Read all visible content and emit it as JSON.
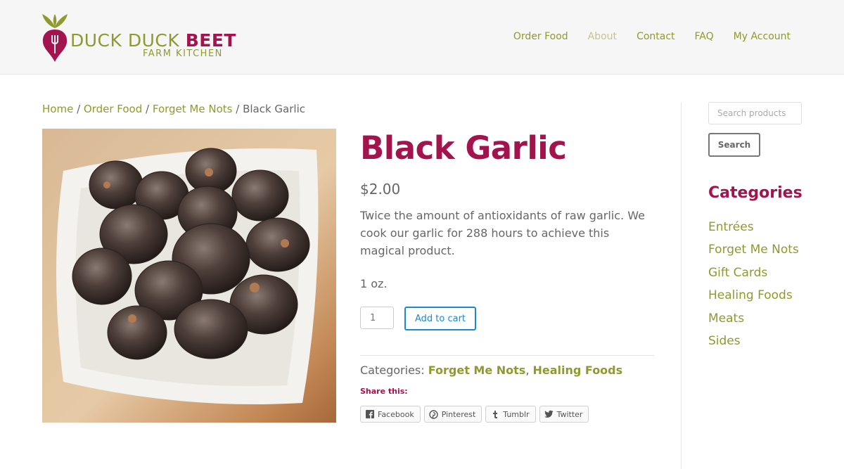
{
  "header": {
    "logo": {
      "line1": "DUCK DUCK ",
      "line1_bold": "BEET",
      "line2": "FARM KITCHEN"
    },
    "nav": [
      {
        "label": "Order Food",
        "active": false
      },
      {
        "label": "About",
        "active": true
      },
      {
        "label": "Contact",
        "active": false
      },
      {
        "label": "FAQ",
        "active": false
      },
      {
        "label": "My Account",
        "active": false
      }
    ]
  },
  "breadcrumb": {
    "items": [
      "Home",
      "Order Food",
      "Forget Me Nots"
    ],
    "separator": " / ",
    "current": "Black Garlic"
  },
  "product": {
    "title": "Black Garlic",
    "price": "$2.00",
    "description": "Twice the amount of antioxidants of raw garlic. We cook our garlic for 288 hours to achieve this magical product.",
    "weight": "1 oz.",
    "quantity": "1",
    "add_to_cart": "Add to cart",
    "categories_label": "Categories: ",
    "categories": [
      "Forget Me Nots",
      "Healing Foods"
    ],
    "categories_separator": ", ",
    "share_label": "Share this:",
    "share_buttons": [
      {
        "label": "Facebook",
        "icon": "facebook-icon"
      },
      {
        "label": "Pinterest",
        "icon": "pinterest-icon"
      },
      {
        "label": "Tumblr",
        "icon": "tumblr-icon"
      },
      {
        "label": "Twitter",
        "icon": "twitter-icon"
      }
    ]
  },
  "sidebar": {
    "search_placeholder": "Search products",
    "search_button": "Search",
    "categories_heading": "Categories",
    "categories": [
      "Entrées",
      "Forget Me Nots",
      "Gift Cards",
      "Healing Foods",
      "Meats",
      "Sides"
    ]
  },
  "colors": {
    "brand_magenta": "#a3134e",
    "brand_olive": "#8e9a2e",
    "button_blue": "#1b8ac9"
  }
}
